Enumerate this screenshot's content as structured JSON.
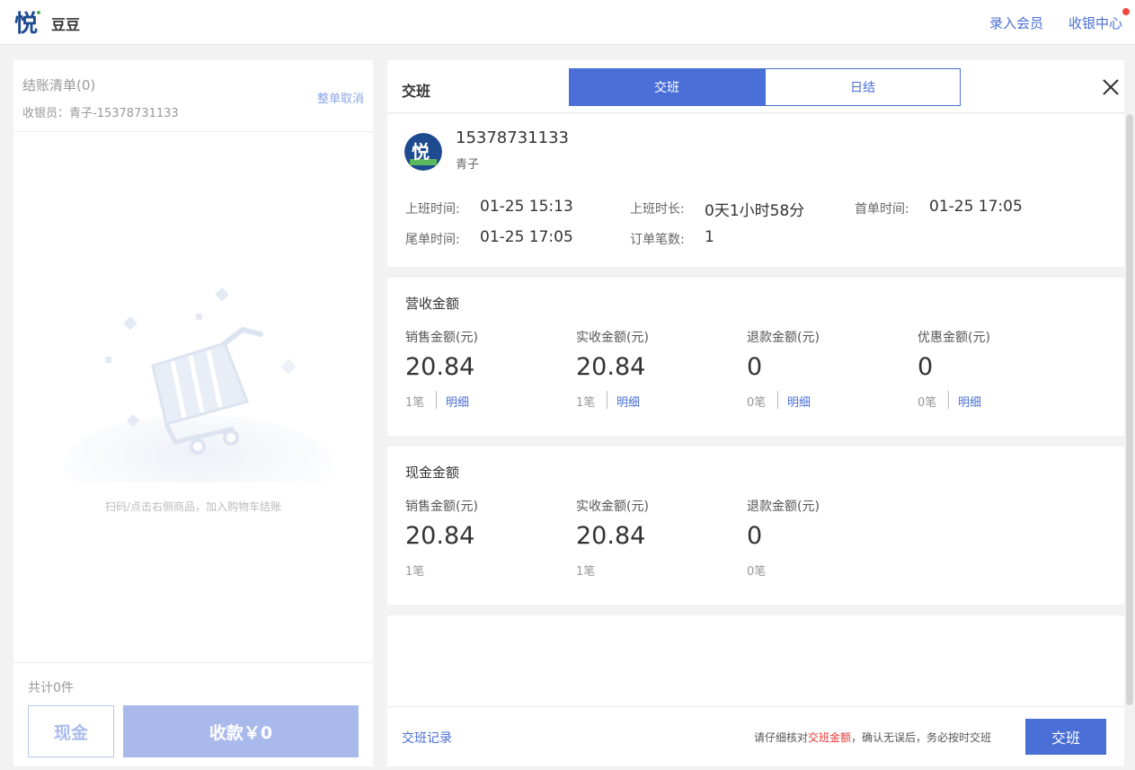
{
  "header": {
    "logo_char": "悦",
    "store_name": "豆豆",
    "enter_member": "录入会员",
    "cashier_center": "收银中心"
  },
  "cart": {
    "title": "结账清单(0)",
    "cashier_info": "收银员：青子-15378731133",
    "cancel_all": "整单取消",
    "empty_tip": "扫码/点击右侧商品，加入购物车结账",
    "total_count": "共计0件",
    "cash_button": "现金",
    "collect_button": "收款￥0"
  },
  "shift": {
    "title": "交班",
    "tabs": [
      {
        "label": "交班",
        "active": true
      },
      {
        "label": "日结",
        "active": false
      }
    ],
    "user": {
      "avatar_char": "悦",
      "phone": "15378731133",
      "name": "青子"
    },
    "info": [
      {
        "label": "上班时间:",
        "value": "01-25 15:13"
      },
      {
        "label": "上班时长:",
        "value": "0天1小时58分"
      },
      {
        "label": "首单时间:",
        "value": "01-25 17:05"
      },
      {
        "label": "尾单时间:",
        "value": "01-25 17:05"
      },
      {
        "label": "订单笔数:",
        "value": "1"
      }
    ],
    "revenue": {
      "title": "营收金额",
      "metrics": [
        {
          "label": "销售金额(元)",
          "value": "20.84",
          "count": "1笔",
          "detail": "明细"
        },
        {
          "label": "实收金额(元)",
          "value": "20.84",
          "count": "1笔",
          "detail": "明细"
        },
        {
          "label": "退款金额(元)",
          "value": "0",
          "count": "0笔",
          "detail": "明细"
        },
        {
          "label": "优惠金额(元)",
          "value": "0",
          "count": "0笔",
          "detail": "明细"
        }
      ]
    },
    "cash": {
      "title": "现金金额",
      "metrics": [
        {
          "label": "销售金额(元)",
          "value": "20.84",
          "count": "1笔"
        },
        {
          "label": "实收金额(元)",
          "value": "20.84",
          "count": "1笔"
        },
        {
          "label": "退款金额(元)",
          "value": "0",
          "count": "0笔"
        }
      ]
    },
    "footer": {
      "record_link": "交班记录",
      "notice_prefix": "请仔细核对",
      "notice_highlight": "交班金额",
      "notice_suffix": "，确认无误后，务必按时交班",
      "submit_button": "交班"
    }
  },
  "colors": {
    "accent": "#4a6fd6",
    "highlight": "#e53935",
    "disabled_button": "#a9b9ec"
  }
}
